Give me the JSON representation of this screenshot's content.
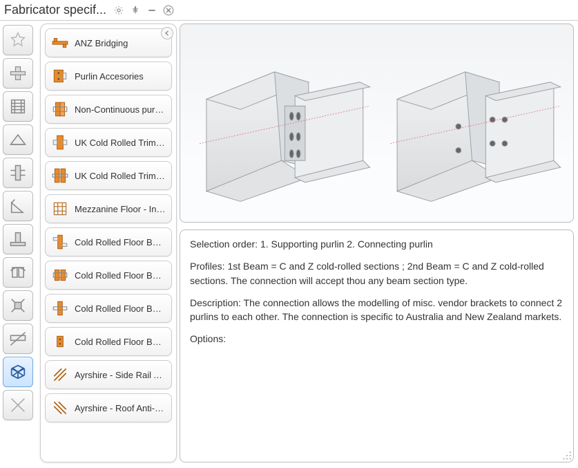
{
  "window": {
    "title": "Fabricator specif..."
  },
  "sidebar": {
    "items": [
      {
        "name": "favorites",
        "selected": false
      },
      {
        "name": "beam-connections",
        "selected": false
      },
      {
        "name": "column-connections",
        "selected": false
      },
      {
        "name": "roof-connections",
        "selected": false
      },
      {
        "name": "bracing",
        "selected": false
      },
      {
        "name": "angle-tool",
        "selected": false
      },
      {
        "name": "base-plates",
        "selected": false
      },
      {
        "name": "splice",
        "selected": false
      },
      {
        "name": "misc-1",
        "selected": false
      },
      {
        "name": "purlin-tools",
        "selected": false
      },
      {
        "name": "fabricator-specific",
        "selected": true
      },
      {
        "name": "crossed",
        "selected": false
      }
    ]
  },
  "list": {
    "items": [
      {
        "label": "ANZ Bridging",
        "icon": "bridging"
      },
      {
        "label": "Purlin Accesories",
        "icon": "purlin-acc"
      },
      {
        "label": "Non-Continuous purli...",
        "icon": "noncont"
      },
      {
        "label": "UK Cold Rolled Trimm...",
        "icon": "trimmer1"
      },
      {
        "label": "UK Cold Rolled Trimm...",
        "icon": "trimmer2"
      },
      {
        "label": "Mezzanine Floor - Inset",
        "icon": "mezz"
      },
      {
        "label": "Cold Rolled Floor Bea...",
        "icon": "floorbeam1"
      },
      {
        "label": "Cold Rolled Floor Bea...",
        "icon": "floorbeam2"
      },
      {
        "label": "Cold Rolled Floor Bea...",
        "icon": "floorbeam3"
      },
      {
        "label": "Cold Rolled Floor Bea...",
        "icon": "floorbeam4"
      },
      {
        "label": "Ayrshire - Side Rail An...",
        "icon": "sidrail"
      },
      {
        "label": "Ayrshire - Roof Anti-S...",
        "icon": "roofanti"
      }
    ]
  },
  "description": {
    "selection_order": "Selection order: 1. Supporting purlin 2. Connecting purlin",
    "profiles": "Profiles: 1st Beam = C and Z cold-rolled sections ; 2nd Beam = C and Z cold-rolled sections. The connection will accept thou any beam section type.",
    "description": "Description: The connection allows the modelling of misc. vendor brackets to connect 2 purlins to each other. The connection is specific to Australia and New Zealand markets.",
    "options": "Options:"
  }
}
